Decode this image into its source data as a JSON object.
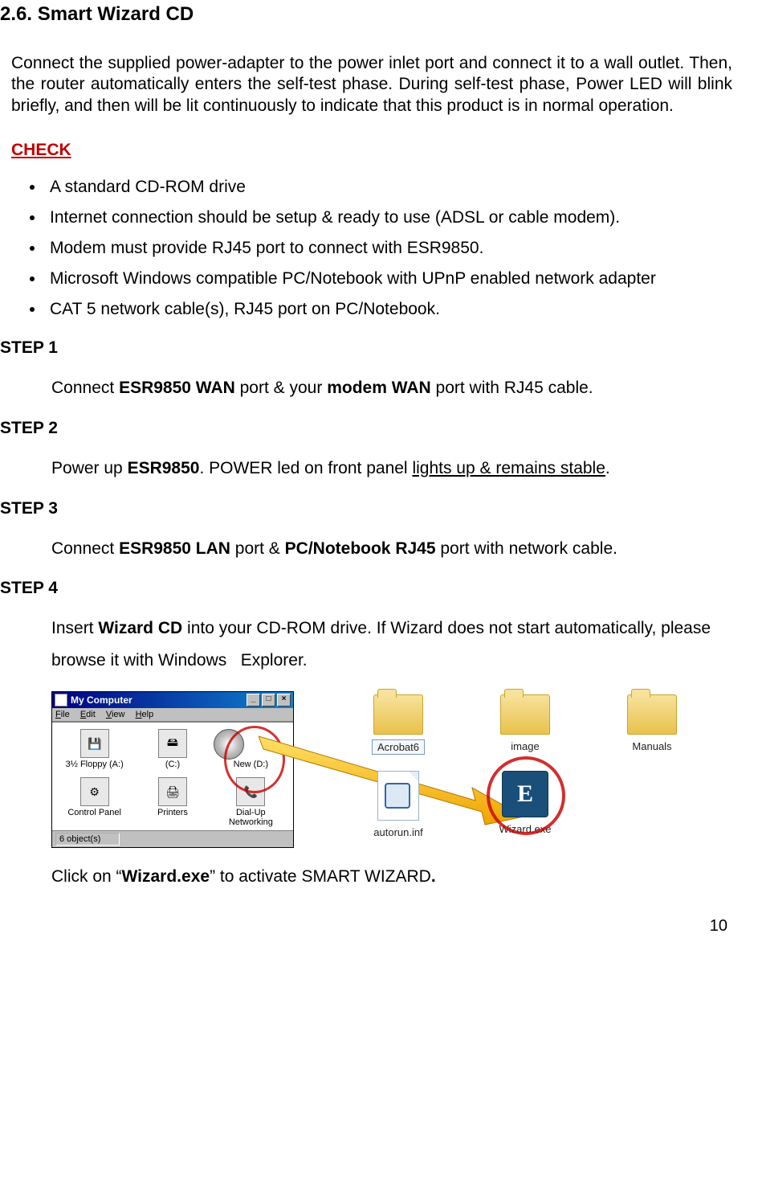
{
  "section_heading": "2.6. Smart Wizard CD",
  "intro": "Connect the supplied power-adapter to the power inlet port and connect it to a wall outlet. Then, the router automatically enters the self-test phase. During self-test phase, Power LED will blink briefly, and then will be lit continuously to indicate that this product is in normal operation.",
  "check_heading": "CHECK",
  "check_items": [
    "A standard CD-ROM drive",
    "Internet connection should be setup & ready to use (ADSL or cable modem).",
    "Modem must provide RJ45 port to connect with ESR9850.",
    "Microsoft Windows compatible PC/Notebook with UPnP enabled network adapter",
    "CAT 5 network cable(s), RJ45 port on PC/Notebook."
  ],
  "steps": {
    "s1_label": "STEP 1",
    "s1_prefix": "Connect ",
    "s1_b1": "ESR9850 WAN",
    "s1_mid": " port & your ",
    "s1_b2": "modem WAN",
    "s1_suffix": " port with RJ45 cable.",
    "s2_label": "STEP 2",
    "s2_prefix": "Power up ",
    "s2_b1": "ESR9850",
    "s2_mid": ". POWER led on front panel ",
    "s2_u": "lights up & remains stable",
    "s2_suffix": ".",
    "s3_label": "STEP 3",
    "s3_prefix": "Connect ",
    "s3_b1": "ESR9850 LAN",
    "s3_mid": " port & ",
    "s3_b2": "PC/Notebook RJ45",
    "s3_suffix": " port with network cable.",
    "s4_label": "STEP 4",
    "s4_prefix": "Insert ",
    "s4_b1": "Wizard CD",
    "s4_rest": " into your CD-ROM drive. If Wizard does not start automatically, please browse it with Windows   Explorer."
  },
  "mycomputer": {
    "title": "My Computer",
    "menu": {
      "file": "File",
      "edit": "Edit",
      "view": "View",
      "help": "Help"
    },
    "items": {
      "floppy": "3½ Floppy (A:)",
      "c": "(C:)",
      "newd": "New (D:)",
      "cp": "Control Panel",
      "printers": "Printers",
      "dialup": "Dial-Up Networking"
    },
    "status": "6 object(s)"
  },
  "folder_view": {
    "acrobat": "Acrobat6",
    "image": "image",
    "manuals": "Manuals",
    "autorun": "autorun.inf",
    "wizard": "Wizard.exe",
    "wizard_letter": "E"
  },
  "after_fig_prefix": "Click on “",
  "after_fig_b": "Wizard.exe",
  "after_fig_suffix": "” to activate SMART WIZARD",
  "after_fig_dot": ".",
  "page_number": "10"
}
